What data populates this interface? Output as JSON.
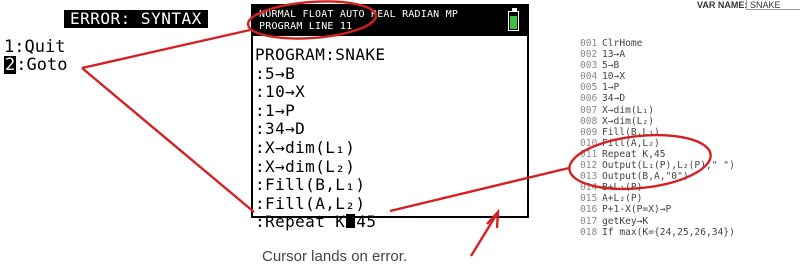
{
  "error_screen": {
    "title": "ERROR: SYNTAX",
    "menu": [
      {
        "num": "1",
        "label": ":Quit",
        "selected": false
      },
      {
        "num": "2",
        "label": ":Goto",
        "selected": true
      }
    ]
  },
  "calculator": {
    "status_line_1": "NORMAL FLOAT AUTO REAL RADIAN MP",
    "status_line_2": "PROGRAM LINE 11",
    "program_name": "PROGRAM:SNAKE",
    "lines": [
      ":5→B",
      ":10→X",
      ":1→P",
      ":34→D",
      ":X→dim(L₁)",
      ":X→dim(L₂)",
      ":Fill(B,L₁)",
      ":Fill(A,L₂)"
    ],
    "cursor_line_before": ":Repeat K",
    "cursor_line_after": "45",
    "battery_color": "#3fbf3f"
  },
  "listing": {
    "varname_label": "VAR NAME:",
    "varname_value": "SNAKE",
    "rows": [
      {
        "num": "001",
        "code": "ClrHome"
      },
      {
        "num": "002",
        "code": "13→A"
      },
      {
        "num": "003",
        "code": "5→B"
      },
      {
        "num": "004",
        "code": "10→X"
      },
      {
        "num": "005",
        "code": "1→P"
      },
      {
        "num": "006",
        "code": "34→D"
      },
      {
        "num": "007",
        "code": "X→dim(L₁)"
      },
      {
        "num": "008",
        "code": "X→dim(L₂)"
      },
      {
        "num": "009",
        "code": "Fill(B,L₁)"
      },
      {
        "num": "010",
        "code": "Fill(A,L₂)"
      },
      {
        "num": "011",
        "code": "Repeat K,45"
      },
      {
        "num": "012",
        "code": "Output(L₁(P),L₂(P),\" \")"
      },
      {
        "num": "013",
        "code": "Output(B,A,\"0\")"
      },
      {
        "num": "014",
        "code": "B+L₁(P)"
      },
      {
        "num": "015",
        "code": "A+L₂(P)"
      },
      {
        "num": "016",
        "code": "P+1-X(P=X)→P"
      },
      {
        "num": "017",
        "code": "getKey→K"
      },
      {
        "num": "018",
        "code": "If max(K={24,25,26,34})"
      }
    ]
  },
  "caption": "Cursor lands on error.",
  "annotation_color": "#d42020"
}
